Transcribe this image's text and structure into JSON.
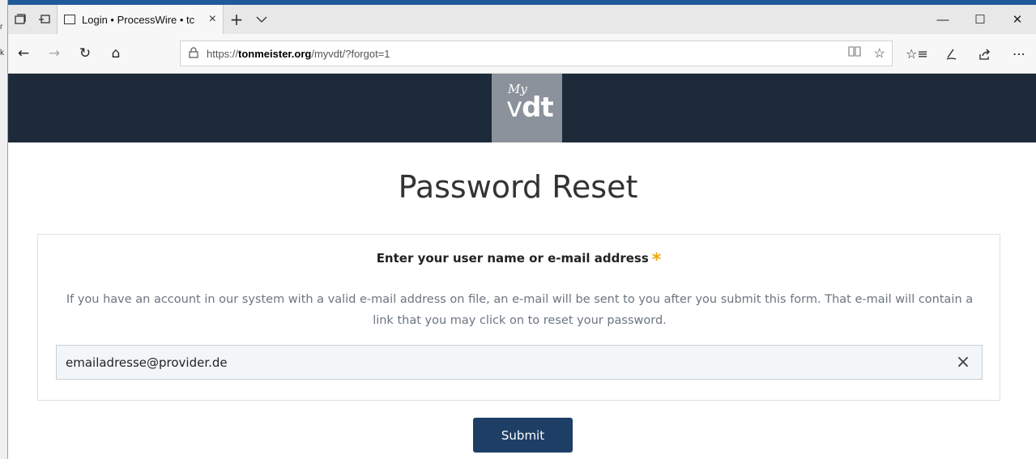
{
  "left_strip": {
    "chars": [
      "r",
      "k"
    ]
  },
  "browser": {
    "tab": {
      "title": "Login • ProcessWire • tc",
      "close": "×"
    },
    "new_tab": "+",
    "tab_dropdown": "∨",
    "window": {
      "minimize": "—",
      "maximize": "☐",
      "close": "✕"
    },
    "nav": {
      "back": "←",
      "forward": "→",
      "refresh": "↻",
      "home": "⌂"
    },
    "address": {
      "prefix": "https://",
      "domain": "tonmeister.org",
      "path": "/myvdt/?forgot=1"
    },
    "icons": [
      "reading-view-icon",
      "favorite-star-icon",
      "favorites-list-icon",
      "pen-icon",
      "share-icon",
      "more-icon"
    ]
  },
  "site": {
    "logo": {
      "my": "My",
      "v": "v",
      "dt": "dt"
    },
    "title": "Password Reset"
  },
  "form": {
    "label": "Enter your user name or e-mail address",
    "required_mark": "*",
    "description": "If you have an account in our system with a valid e-mail address on file, an e-mail will be sent to you after you submit this form. That e-mail will contain a link that you may click on to reset your password.",
    "input_value": "emailadresse@provider.de",
    "clear": "×",
    "submit_label": "Submit"
  }
}
